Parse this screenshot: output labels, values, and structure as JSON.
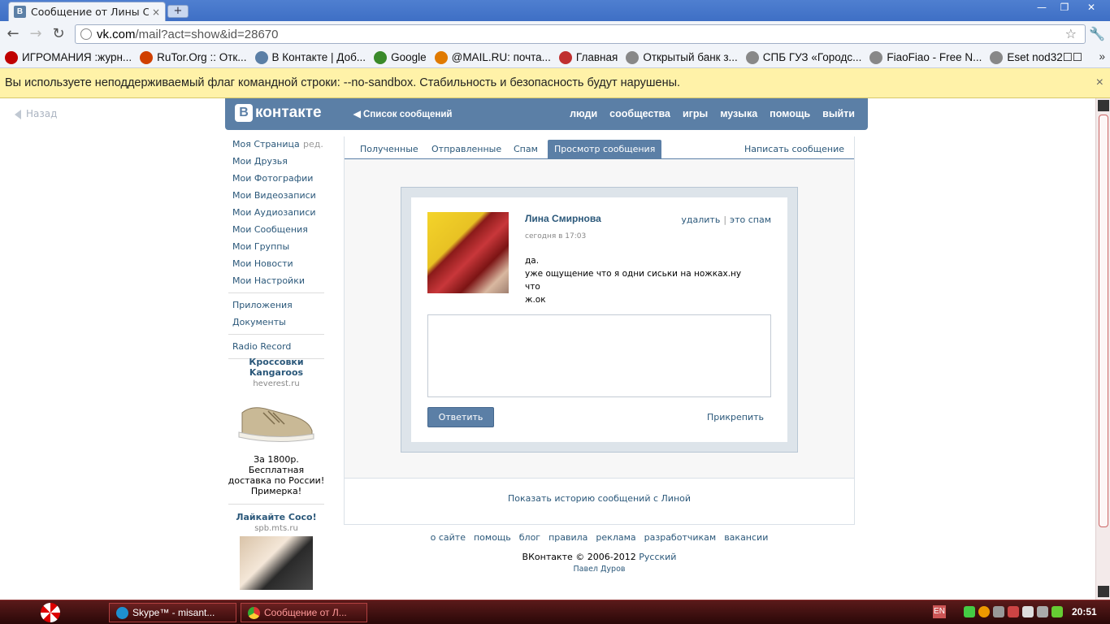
{
  "browser": {
    "tab_title": "Сообщение от Лины Смі",
    "tab_close": "×",
    "new_tab": "+",
    "url_host": "vk.com",
    "url_rest": "/mail?act=show&id=28670",
    "bookmarks": [
      {
        "label": "ИГРОМАНИЯ :журн...",
        "color": "#c00000"
      },
      {
        "label": "RuTor.Org :: Отк...",
        "color": "#d04000"
      },
      {
        "label": "В Контакте | Доб...",
        "color": "#5b7fa6"
      },
      {
        "label": "Google",
        "color": "#3a8a2a"
      },
      {
        "label": "@MAIL.RU: почта...",
        "color": "#e07a00"
      },
      {
        "label": "Главная",
        "color": "#c03030"
      },
      {
        "label": "Открытый банк з...",
        "color": "#888888"
      },
      {
        "label": "СПБ ГУЗ «Городс...",
        "color": "#888888"
      },
      {
        "label": "FiaoFiao - Free N...",
        "color": "#888888"
      },
      {
        "label": "Eset nod32☐☐",
        "color": "#888888"
      }
    ],
    "bookmarks_more": "»",
    "infobar_text": "Вы используете неподдерживаемый флаг командной строки: --no-sandbox. Стабильность и безопасность будут нарушены.",
    "infobar_close": "×"
  },
  "page": {
    "back_label": "Назад",
    "logo_b": "В",
    "logo_text": "контакте",
    "head_list": "Список сообщений",
    "head_nav": [
      "люди",
      "сообщества",
      "игры",
      "музыка",
      "помощь",
      "выйти"
    ],
    "left_menu": [
      "Моя Страница",
      "Мои Друзья",
      "Мои Фотографии",
      "Мои Видеозаписи",
      "Мои Аудиозаписи",
      "Мои Сообщения",
      "Мои Группы",
      "Мои Новости",
      "Мои Настройки"
    ],
    "left_menu_edit": "ред.",
    "left_menu_2": [
      "Приложения",
      "Документы"
    ],
    "left_menu_3": [
      "Radio Record"
    ],
    "ads": [
      {
        "title": "Кроссовки Kangaroos",
        "domain": "heverest.ru",
        "text": "За 1800р. Бесплатная доставка по России! Примерка!"
      },
      {
        "title": "Лайкайте Coco!",
        "domain": "spb.mts.ru"
      }
    ],
    "tabs": [
      "Полученные",
      "Отправленные",
      "Спам",
      "Просмотр сообщения"
    ],
    "write_link": "Написать сообщение",
    "message": {
      "sender": "Лина Смирнова",
      "delete": "удалить",
      "sep": "|",
      "spam": "это спам",
      "time": "сегодня в 17:03",
      "lines": [
        "да.",
        "уже ощущение что я одни сиськи на ножках.ну что",
        "ж.ок"
      ]
    },
    "reply_button": "Ответить",
    "attach": "Прикрепить",
    "history_link": "Показать историю сообщений с Линой",
    "footer_links": [
      "о сайте",
      "помощь",
      "блог",
      "правила",
      "реклама",
      "разработчикам",
      "вакансии"
    ],
    "copyright": "ВКонтакте © 2006-2012",
    "language": "Русский",
    "durov": "Павел Дуров"
  },
  "taskbar": {
    "tasks": [
      {
        "label": "Skype™ - misant...",
        "color": "#1e90d0"
      },
      {
        "label": "Сообщение от Л...",
        "color": "#3a9a3a"
      }
    ],
    "lang": "EN",
    "clock": "20:51"
  }
}
